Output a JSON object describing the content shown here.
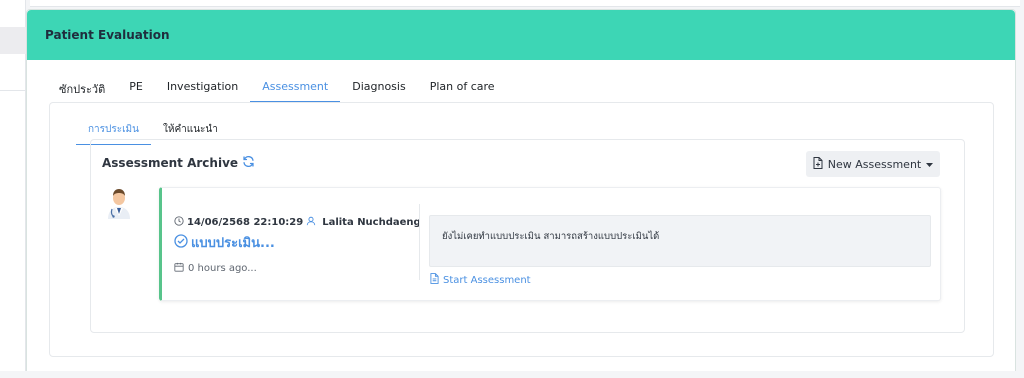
{
  "card": {
    "title": "Patient Evaluation"
  },
  "tabs": [
    {
      "label": "ซักประวัติ",
      "active": false
    },
    {
      "label": "PE",
      "active": false
    },
    {
      "label": "Investigation",
      "active": false
    },
    {
      "label": "Assessment",
      "active": true
    },
    {
      "label": "Diagnosis",
      "active": false
    },
    {
      "label": "Plan of care",
      "active": false
    }
  ],
  "subtabs": [
    {
      "label": "การประเมิน",
      "active": true
    },
    {
      "label": "ให้คำแนะนำ",
      "active": false
    }
  ],
  "archive": {
    "title": "Assessment Archive",
    "refresh_icon": "refresh-icon",
    "new_button_label": "New Assessment",
    "new_button_icon": "file-plus-icon"
  },
  "record": {
    "datetime": "14/06/2568 22:10:29",
    "author": "Lalita Nuchdaeng",
    "status_text": "แบบประเมิน...",
    "relative_time": "0 hours ago...",
    "notice": "ยังไม่เคยทำแบบประเมิน สามารถสร้างแบบประเมินได้",
    "start_link": "Start Assessment"
  },
  "colors": {
    "header_bg": "#3dd6b5",
    "accent": "#4a90e2",
    "record_border": "#58c48b"
  }
}
